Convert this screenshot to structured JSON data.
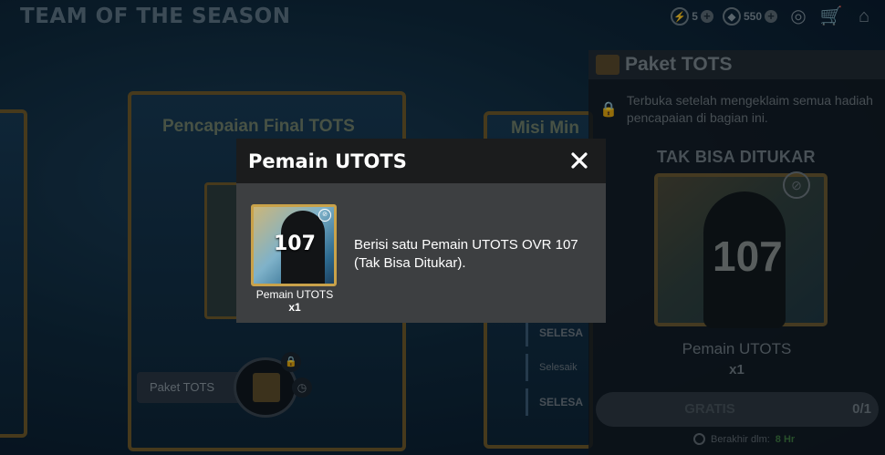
{
  "page": {
    "title": "TEAM OF THE SEASON"
  },
  "topbar": {
    "currency1": {
      "icon": "token-icon",
      "value": "5"
    },
    "currency2": {
      "icon": "gem-icon",
      "value": "550"
    }
  },
  "background": {
    "center_card_title": "Pencapaian Final TOTS",
    "right_card_title": "Misi Min",
    "pack_label": "Paket TOTS",
    "mini_rows": [
      "SELESA",
      "Selesaik",
      "SELESA"
    ]
  },
  "right_panel": {
    "title": "Paket TOTS",
    "note": "Terbuka setelah mengeklaim semua hadiah pencapaian di bagian ini.",
    "tag": "TAK BISA DITUKAR",
    "card_ovr": "107",
    "item_name": "Pemain UTOTS",
    "item_qty": "x1",
    "button_label": "GRATIS",
    "progress": "0/1",
    "ends_label": "Berakhir dlm:",
    "ends_value": "8 Hr"
  },
  "modal": {
    "title": "Pemain UTOTS",
    "card_ovr": "107",
    "card_name": "Pemain UTOTS",
    "card_qty": "x1",
    "description": "Berisi satu Pemain UTOTS OVR 107 (Tak Bisa Ditukar)."
  }
}
